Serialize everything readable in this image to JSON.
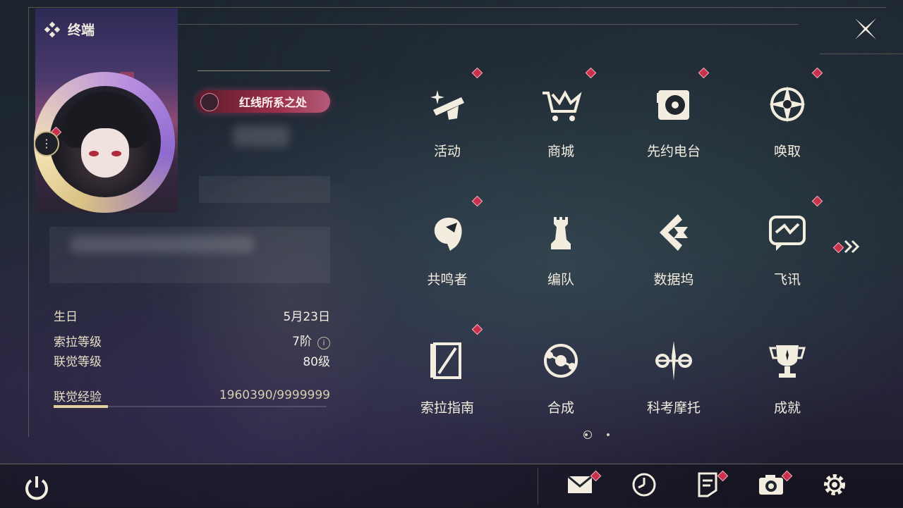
{
  "header": {
    "title": "终端",
    "title_icon": "diamond-cluster-icon",
    "close_icon": "close-x-icon"
  },
  "profile": {
    "badge_text": "红线所系之处",
    "menu_icon": "more-vertical-icon",
    "stats": [
      {
        "label": "生日",
        "value": "5月23日"
      },
      {
        "label": "索拉等级",
        "value": "7阶",
        "has_info": true
      },
      {
        "label": "联觉等级",
        "value": "80级"
      }
    ],
    "exp": {
      "label": "联觉经验",
      "value": "1960390/9999999",
      "progress": 0.196
    }
  },
  "grid": {
    "items": [
      {
        "label": "活动",
        "icon": "activity-sparkle-icon",
        "notify": true
      },
      {
        "label": "商城",
        "icon": "crown-cart-icon",
        "notify": true
      },
      {
        "label": "先约电台",
        "icon": "radio-turntable-icon",
        "notify": true
      },
      {
        "label": "唤取",
        "icon": "compass-star-icon",
        "notify": true
      },
      {
        "label": "共鸣者",
        "icon": "character-head-icon",
        "notify": true
      },
      {
        "label": "编队",
        "icon": "chess-rook-icon",
        "notify": false
      },
      {
        "label": "数据坞",
        "icon": "data-dock-icon",
        "notify": false
      },
      {
        "label": "飞讯",
        "icon": "chat-message-icon",
        "notify": true
      },
      {
        "label": "索拉指南",
        "icon": "guide-book-icon",
        "notify": true
      },
      {
        "label": "合成",
        "icon": "synthesis-orb-icon",
        "notify": false
      },
      {
        "label": "科考摩托",
        "icon": "motorcycle-icon",
        "notify": false
      },
      {
        "label": "成就",
        "icon": "trophy-icon",
        "notify": false
      }
    ],
    "next_page_icon": "double-chevron-right-icon",
    "pages": 2,
    "current_page": 1
  },
  "bottom_bar": {
    "power_icon": "power-icon",
    "icons": [
      {
        "name": "mail-icon",
        "notify": true
      },
      {
        "name": "clock-icon",
        "notify": false
      },
      {
        "name": "notice-icon",
        "notify": true
      },
      {
        "name": "camera-icon",
        "notify": true
      },
      {
        "name": "settings-gear-icon",
        "notify": false
      }
    ]
  },
  "colors": {
    "accent": "#e3cf9f",
    "notify": "#c9304b",
    "text": "#f3ede0"
  }
}
